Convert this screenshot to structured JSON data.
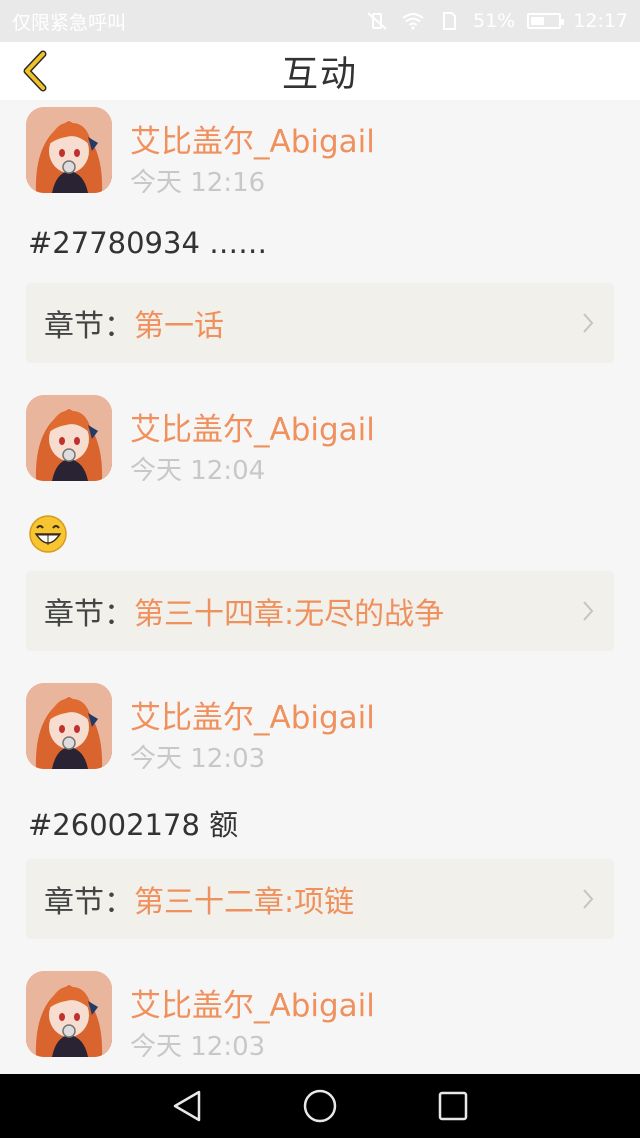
{
  "status_bar": {
    "left_text": "仅限紧急呼叫",
    "battery_percent": "51%",
    "battery_level": 0.51,
    "time": "12:17",
    "icons": [
      "vibrate-off-icon",
      "wifi-icon",
      "sim-icon",
      "battery-icon"
    ]
  },
  "navbar": {
    "back_icon": "chevron-left-icon",
    "title": "互动",
    "accent_color": "#f0c228"
  },
  "theme": {
    "accent": "#f0905c",
    "chapter_bg": "#f1f0eb",
    "time_color": "#c8c8c8"
  },
  "feed": [
    {
      "username": "艾比盖尔_Abigail",
      "time": "今天 12:16",
      "content": "#27780934 ……",
      "content_type": "text",
      "chapter_label": "章节：",
      "chapter_title": "第一话"
    },
    {
      "username": "艾比盖尔_Abigail",
      "time": "今天 12:04",
      "content": "",
      "content_type": "emoji",
      "emoji_icon": "grinning-face-icon",
      "chapter_label": "章节：",
      "chapter_title": "第三十四章:无尽的战争"
    },
    {
      "username": "艾比盖尔_Abigail",
      "time": "今天 12:03",
      "content": "#26002178 额",
      "content_type": "text",
      "chapter_label": "章节：",
      "chapter_title": "第三十二章:项链"
    },
    {
      "username": "艾比盖尔_Abigail",
      "time": "今天 12:03"
    }
  ],
  "system_nav": {
    "back": "triangle-back-icon",
    "home": "circle-home-icon",
    "recents": "square-recents-icon"
  }
}
